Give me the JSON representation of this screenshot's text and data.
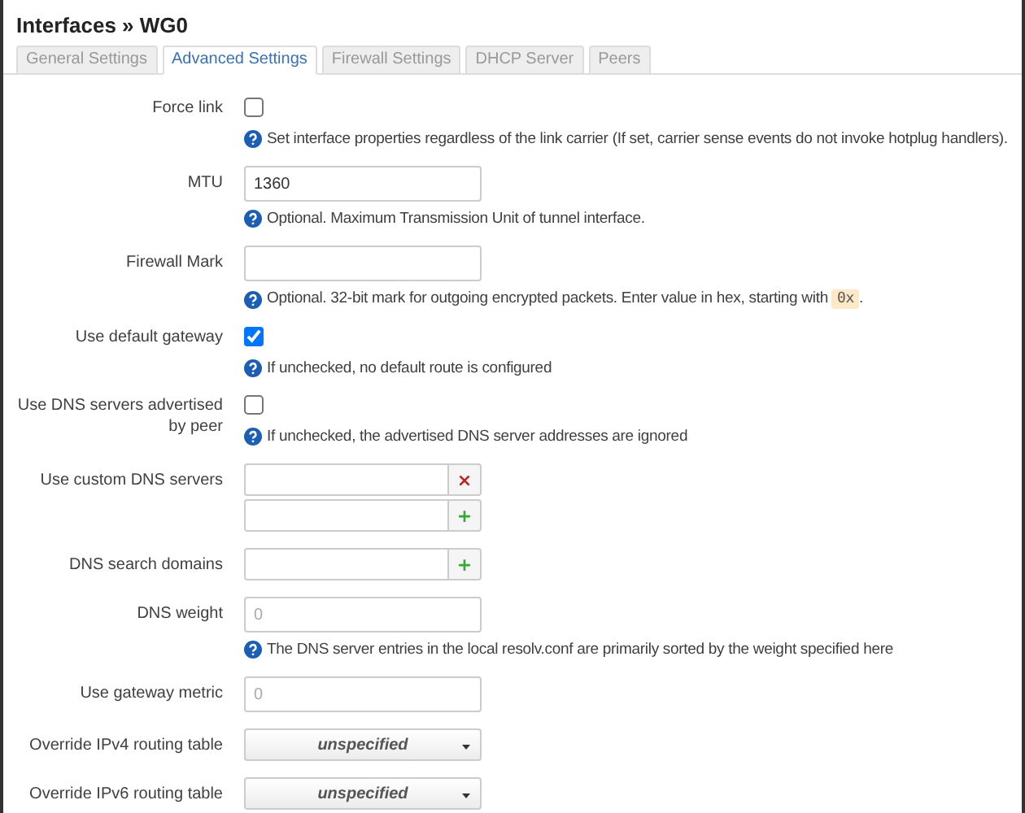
{
  "title": "Interfaces » WG0",
  "tabs": [
    {
      "label": "General Settings",
      "selected": false
    },
    {
      "label": "Advanced Settings",
      "selected": true
    },
    {
      "label": "Firewall Settings",
      "selected": false
    },
    {
      "label": "DHCP Server",
      "selected": false
    },
    {
      "label": "Peers",
      "selected": false
    }
  ],
  "fields": [
    {
      "kind": "checkbox",
      "label": "Force link",
      "checked": false,
      "help": {
        "text": "Set interface properties regardless of the link carrier (If set, carrier sense events do not invoke hotplug handlers)."
      }
    },
    {
      "kind": "text",
      "label": "MTU",
      "value": "1360",
      "help": {
        "text": "Optional. Maximum Transmission Unit of tunnel interface."
      }
    },
    {
      "kind": "text",
      "label": "Firewall Mark",
      "help": {
        "text": "Optional. 32-bit mark for outgoing encrypted packets. Enter value in hex, starting with",
        "code": "0x",
        "after": "."
      }
    },
    {
      "kind": "checkbox",
      "label": "Use default gateway",
      "checked": true,
      "help": {
        "text": "If unchecked, no default route is configured"
      }
    },
    {
      "kind": "checkbox",
      "label": "Use DNS servers advertised by peer",
      "checked": false,
      "help": {
        "text": "If unchecked, the advertised DNS server addresses are ignored"
      }
    },
    {
      "kind": "list",
      "label": "Use custom DNS servers",
      "entries": [
        {
          "button": "×",
          "kind": "remove"
        },
        {
          "button": "+",
          "kind": "add"
        }
      ]
    },
    {
      "kind": "list",
      "label": "DNS search domains",
      "entries": [
        {
          "button": "+",
          "kind": "add"
        }
      ]
    },
    {
      "kind": "text",
      "label": "DNS weight",
      "placeholder": "0",
      "help": {
        "text": "The DNS server entries in the local resolv.conf are primarily sorted by the weight specified here"
      }
    },
    {
      "kind": "text",
      "label": "Use gateway metric",
      "placeholder": "0"
    },
    {
      "kind": "select",
      "label": "Override IPv4 routing table",
      "value": "unspecified"
    },
    {
      "kind": "select",
      "label": "Override IPv6 routing table",
      "value": "unspecified"
    }
  ]
}
